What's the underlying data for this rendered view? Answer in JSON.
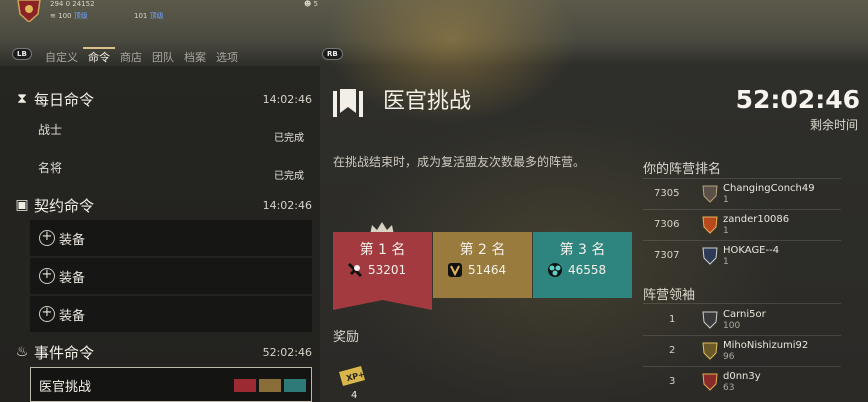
{
  "top_stats": {
    "stat_a": "294 0 24152",
    "stat_b_num": "100",
    "stat_b_lvl": "顶级",
    "stat_c_num": "101",
    "stat_c_lvl": "顶级",
    "stat_d": "5"
  },
  "controller": {
    "lb": "LB",
    "rb": "RB"
  },
  "tabs": [
    "自定义",
    "命令",
    "商店",
    "团队",
    "档案",
    "选项"
  ],
  "active_tab": "命令",
  "daily": {
    "title": "每日命令",
    "time": "14:02:46",
    "items": [
      {
        "name": "战士",
        "status": "已完成"
      },
      {
        "name": "名将",
        "status": "已完成"
      }
    ]
  },
  "contract": {
    "title": "契约命令",
    "time": "14:02:46",
    "items": [
      "装备",
      "装备",
      "装备"
    ]
  },
  "event": {
    "title": "事件命令",
    "time": "52:02:46",
    "item_name": "医官挑战"
  },
  "detail": {
    "title": "医官挑战",
    "timer": "52:02:46",
    "timer_label": "剩余时间",
    "description": "在挑战结束时，成为复活盟友次数最多的阵营。",
    "ranks": [
      {
        "label": "第 1 名",
        "score": "53201",
        "color": "#a33a40"
      },
      {
        "label": "第 2 名",
        "score": "51464",
        "color": "#9a7b3e"
      },
      {
        "label": "第 3 名",
        "score": "46558",
        "color": "#2e8580"
      }
    ],
    "reward_heading": "奖励",
    "reward_icon": "XP+",
    "reward_qty": "4"
  },
  "faction_ranking": {
    "heading": "你的阵营排名",
    "rows": [
      {
        "rank": "7305",
        "name": "ChangingConch49",
        "score": "1"
      },
      {
        "rank": "7306",
        "name": "zander10086",
        "score": "1"
      },
      {
        "rank": "7307",
        "name": "HOKAGE--4",
        "score": "1"
      }
    ]
  },
  "faction_leaders": {
    "heading": "阵营领袖",
    "rows": [
      {
        "rank": "1",
        "name": "Carni5or",
        "score": "100"
      },
      {
        "rank": "2",
        "name": "MihoNishizumi92",
        "score": "96"
      },
      {
        "rank": "3",
        "name": "d0nn3y",
        "score": "63"
      }
    ]
  },
  "colors": {
    "accent_gold": "#d9c28b",
    "knight_red": "#a33a40",
    "viking_gold": "#9a7b3e",
    "samurai_teal": "#2e8580",
    "level_blue": "#6fa3ff"
  }
}
